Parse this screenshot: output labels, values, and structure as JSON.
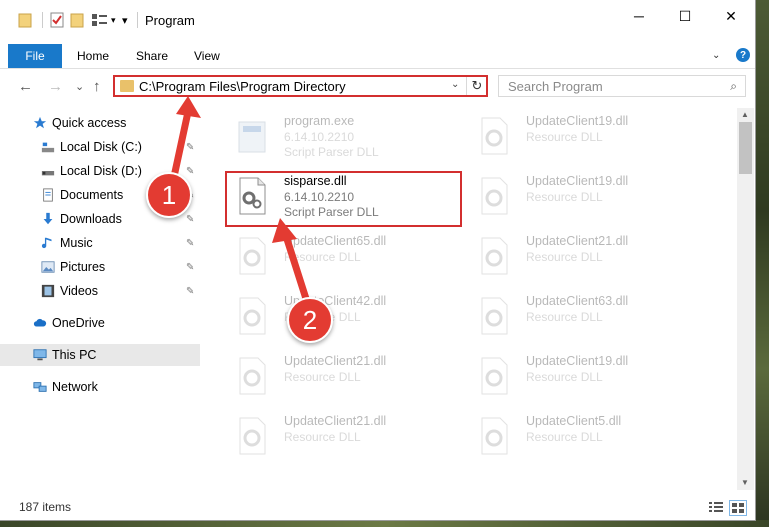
{
  "window": {
    "title": "Program"
  },
  "ribbon": {
    "tabs": [
      "File",
      "Home",
      "Share",
      "View"
    ],
    "help": "?"
  },
  "window_controls": {
    "minimize": "─",
    "maximize": "☐",
    "close": "✕"
  },
  "address": {
    "path": "C:\\Program Files\\Program Directory",
    "dropdown": "⌄",
    "refresh": "↻"
  },
  "search": {
    "placeholder": "Search Program",
    "icon": "⌕"
  },
  "nav_buttons": {
    "back": "←",
    "forward": "→",
    "down": "⌄",
    "up": "↑"
  },
  "sidebar": {
    "items": [
      {
        "label": "Quick access",
        "icon": "star-icon",
        "pinned": false
      },
      {
        "label": "Local Disk (C:)",
        "icon": "drive-icon",
        "pinned": true
      },
      {
        "label": "Local Disk (D:)",
        "icon": "drive-icon",
        "pinned": true
      },
      {
        "label": "Documents",
        "icon": "documents-icon",
        "pinned": true
      },
      {
        "label": "Downloads",
        "icon": "download-icon",
        "pinned": true
      },
      {
        "label": "Music",
        "icon": "music-icon",
        "pinned": true
      },
      {
        "label": "Pictures",
        "icon": "pictures-icon",
        "pinned": true
      },
      {
        "label": "Videos",
        "icon": "videos-icon",
        "pinned": true
      },
      {
        "label": "OneDrive",
        "icon": "cloud-icon",
        "pinned": false
      },
      {
        "label": "This PC",
        "icon": "computer-icon",
        "pinned": false,
        "selected": true
      },
      {
        "label": "Network",
        "icon": "network-icon",
        "pinned": false
      }
    ],
    "pin_glyph": "📌"
  },
  "files": [
    {
      "name": "program.exe",
      "version": "6.14.10.2210",
      "description": "Script Parser DLL",
      "icon": "exe-icon",
      "faded": true
    },
    {
      "name": "UpdateClient19.dll",
      "version": "Resource DLL",
      "description": "",
      "icon": "dll-icon",
      "faded": true
    },
    {
      "name": "sisparse.dll",
      "version": "6.14.10.2210",
      "description": "Script Parser DLL",
      "icon": "dll-gear-icon",
      "faded": false
    },
    {
      "name": "UpdateClient19.dll",
      "version": "Resource DLL",
      "description": "",
      "icon": "dll-icon",
      "faded": true
    },
    {
      "name": "UpdateClient65.dll",
      "version": "Resource DLL",
      "description": "",
      "icon": "dll-icon",
      "faded": true
    },
    {
      "name": "UpdateClient21.dll",
      "version": "Resource DLL",
      "description": "",
      "icon": "dll-icon",
      "faded": true
    },
    {
      "name": "UpdateClient42.dll",
      "version": "Resource DLL",
      "description": "",
      "icon": "dll-icon",
      "faded": true
    },
    {
      "name": "UpdateClient63.dll",
      "version": "Resource DLL",
      "description": "",
      "icon": "dll-icon",
      "faded": true
    },
    {
      "name": "UpdateClient21.dll",
      "version": "Resource DLL",
      "description": "",
      "icon": "dll-icon",
      "faded": true
    },
    {
      "name": "UpdateClient19.dll",
      "version": "Resource DLL",
      "description": "",
      "icon": "dll-icon",
      "faded": true
    },
    {
      "name": "UpdateClient21.dll",
      "version": "Resource DLL",
      "description": "",
      "icon": "dll-icon",
      "faded": true
    },
    {
      "name": "UpdateClient5.dll",
      "version": "Resource DLL",
      "description": "",
      "icon": "dll-icon",
      "faded": true
    }
  ],
  "status": {
    "count": "187 items"
  },
  "annotations": {
    "step1": "1",
    "step2": "2",
    "color": "#e33b32"
  }
}
